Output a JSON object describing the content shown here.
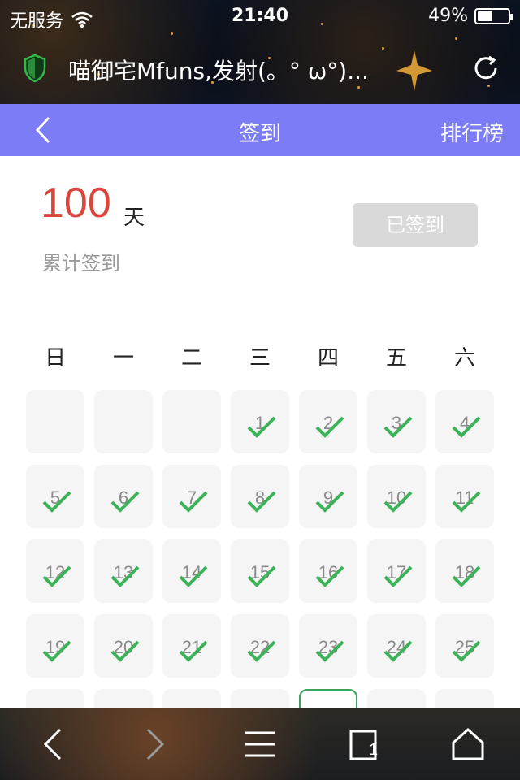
{
  "status_bar": {
    "carrier": "无服务",
    "time": "21:40",
    "battery": "49%",
    "battery_level": 0.49
  },
  "browser": {
    "page_title": "喵御宅Mfuns,发射(。°  ω°)..."
  },
  "header": {
    "title": "签到",
    "right_label": "排行榜",
    "bg_color": "#7b7cf6"
  },
  "summary": {
    "days": "100",
    "days_unit": "天",
    "total_label": "累计签到",
    "signed_button": "已签到"
  },
  "calendar": {
    "weekdays": [
      "日",
      "一",
      "二",
      "三",
      "四",
      "五",
      "六"
    ],
    "days": [
      {
        "day": "",
        "checked": false
      },
      {
        "day": "",
        "checked": false
      },
      {
        "day": "",
        "checked": false
      },
      {
        "day": "1",
        "checked": true
      },
      {
        "day": "2",
        "checked": true
      },
      {
        "day": "3",
        "checked": true
      },
      {
        "day": "4",
        "checked": true
      },
      {
        "day": "5",
        "checked": true
      },
      {
        "day": "6",
        "checked": true
      },
      {
        "day": "7",
        "checked": true
      },
      {
        "day": "8",
        "checked": true
      },
      {
        "day": "9",
        "checked": true
      },
      {
        "day": "10",
        "checked": true
      },
      {
        "day": "11",
        "checked": true
      },
      {
        "day": "12",
        "checked": true
      },
      {
        "day": "13",
        "checked": true
      },
      {
        "day": "14",
        "checked": true
      },
      {
        "day": "15",
        "checked": true
      },
      {
        "day": "16",
        "checked": true
      },
      {
        "day": "17",
        "checked": true
      },
      {
        "day": "18",
        "checked": true
      },
      {
        "day": "19",
        "checked": true
      },
      {
        "day": "20",
        "checked": true
      },
      {
        "day": "21",
        "checked": true
      },
      {
        "day": "22",
        "checked": true
      },
      {
        "day": "23",
        "checked": true
      },
      {
        "day": "24",
        "checked": true
      },
      {
        "day": "25",
        "checked": true
      },
      {
        "day": "",
        "checked": false
      },
      {
        "day": "",
        "checked": false
      },
      {
        "day": "",
        "checked": false
      },
      {
        "day": "",
        "checked": false
      },
      {
        "day": "",
        "checked": false,
        "today": true
      },
      {
        "day": "",
        "checked": false
      },
      {
        "day": "",
        "checked": false
      }
    ],
    "check_color": "#3cb25a"
  },
  "toolbar": {
    "tabs_count": "1",
    "icons": [
      "back-icon",
      "forward-icon",
      "menu-icon",
      "tabs-icon",
      "home-icon"
    ]
  }
}
